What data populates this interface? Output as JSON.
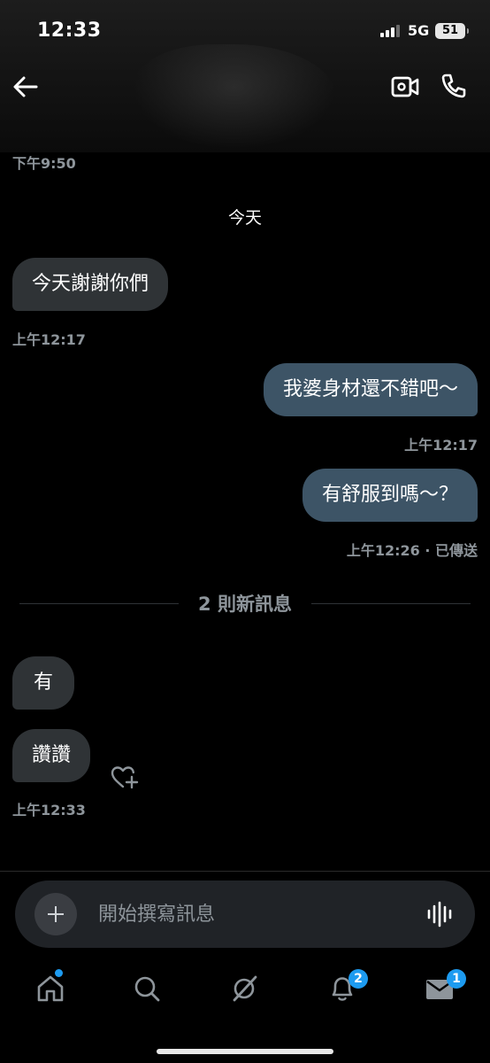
{
  "status_bar": {
    "time": "12:33",
    "network": "5G",
    "battery": "51"
  },
  "header": {
    "back_icon": "arrow-left-icon",
    "video_icon": "video-call-icon",
    "phone_icon": "phone-icon"
  },
  "messages": {
    "earlier_time": "下午9:50",
    "day_label": "今天",
    "m1": {
      "text": "今天謝謝你們",
      "time": "上午12:17"
    },
    "m2": {
      "text": "我婆身材還不錯吧～",
      "time": "上午12:17"
    },
    "m3": {
      "text": "有舒服到嗎～？",
      "time": "上午12:26 · 已傳送"
    },
    "new_divider": "2 則新訊息",
    "m4": {
      "text": "有"
    },
    "m5": {
      "text": "讚讚",
      "time": "上午12:33"
    },
    "reaction_icon": "heart-add-icon"
  },
  "composer": {
    "placeholder": "開始撰寫訊息",
    "add_icon": "plus-icon",
    "voice_icon": "voice-wave-icon"
  },
  "tabbar": {
    "home_icon": "home-icon",
    "search_icon": "search-icon",
    "grok_icon": "grok-icon",
    "notifications_icon": "bell-icon",
    "notifications_badge": "2",
    "messages_icon": "mail-icon",
    "messages_badge": "1"
  },
  "colors": {
    "accent": "#1d9bf0",
    "incoming_bubble": "#2f3336",
    "outgoing_bubble": "#3d5466",
    "muted_text": "#8e959b"
  }
}
